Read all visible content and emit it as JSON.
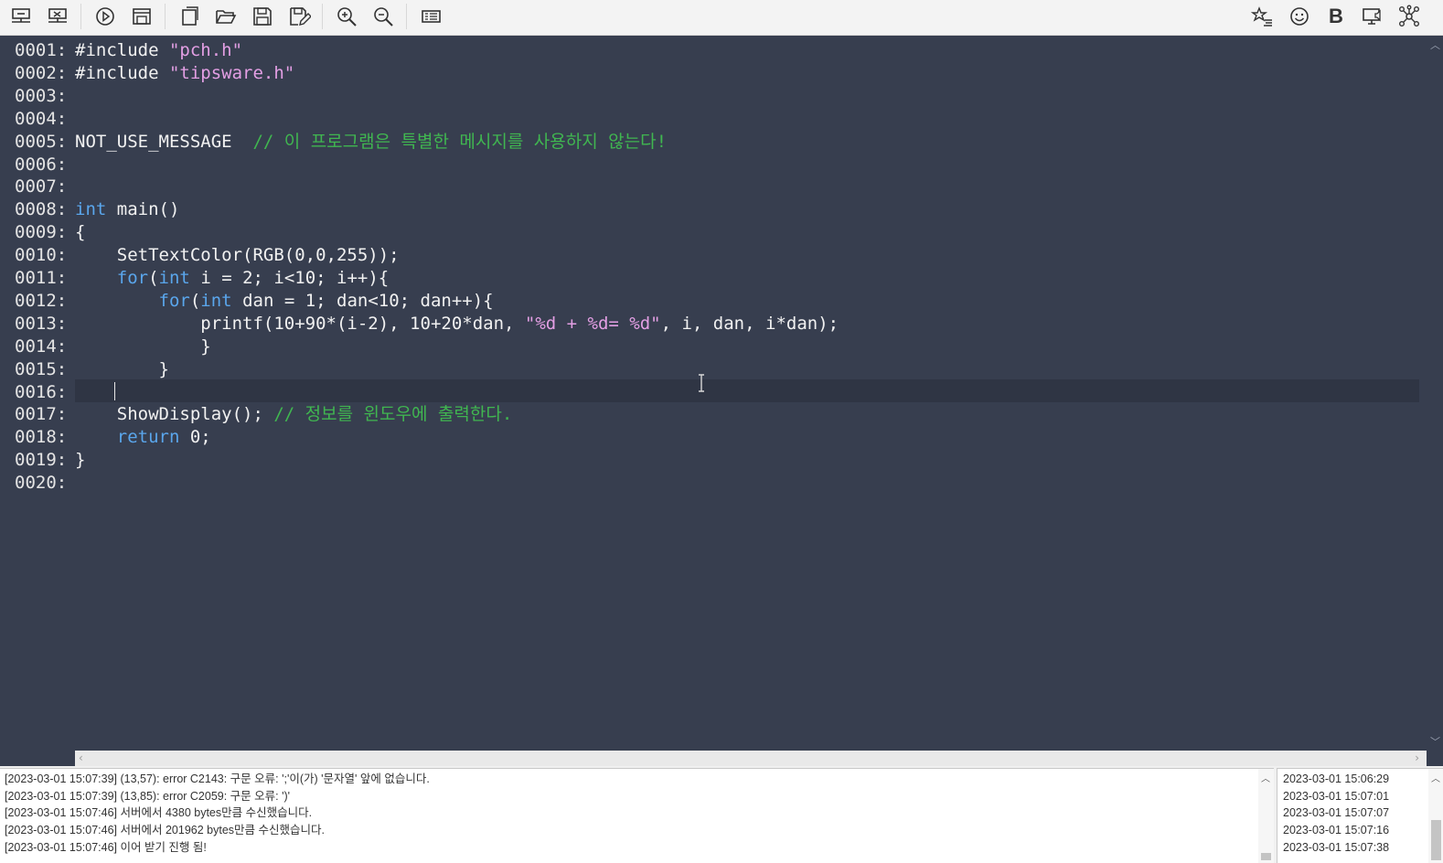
{
  "toolbar": {
    "buttons": [
      {
        "name": "connect-server-button",
        "icon": "monitor-connect-icon"
      },
      {
        "name": "disconnect-server-button",
        "icon": "monitor-disconnect-icon"
      },
      {
        "name": "run-button",
        "icon": "play-circle-icon"
      },
      {
        "name": "open-output-window-button",
        "icon": "window-icon"
      },
      {
        "name": "new-file-button",
        "icon": "new-document-icon"
      },
      {
        "name": "open-file-button",
        "icon": "folder-open-icon"
      },
      {
        "name": "save-button",
        "icon": "floppy-disk-icon"
      },
      {
        "name": "save-as-button",
        "icon": "floppy-edit-icon"
      },
      {
        "name": "zoom-in-button",
        "icon": "zoom-in-icon"
      },
      {
        "name": "zoom-out-button",
        "icon": "zoom-out-icon"
      },
      {
        "name": "toggle-panel-button",
        "icon": "list-panel-icon"
      },
      {
        "name": "favorites-button",
        "icon": "star-list-icon"
      },
      {
        "name": "emoji-button",
        "icon": "smiley-icon"
      },
      {
        "name": "bold-button",
        "icon": "bold-icon",
        "label": "B"
      },
      {
        "name": "broadcast-button",
        "icon": "monitor-speaker-icon"
      },
      {
        "name": "network-button",
        "icon": "network-icon"
      }
    ]
  },
  "editor": {
    "lines": [
      {
        "no": "0001:",
        "indent": "",
        "tokens": [
          {
            "t": "#include ",
            "c": "plain"
          },
          {
            "t": "\"pch.h\"",
            "c": "str"
          }
        ]
      },
      {
        "no": "0002:",
        "indent": "",
        "tokens": [
          {
            "t": "#include ",
            "c": "plain"
          },
          {
            "t": "\"tipsware.h\"",
            "c": "str"
          }
        ]
      },
      {
        "no": "0003:",
        "indent": "",
        "tokens": []
      },
      {
        "no": "0004:",
        "indent": "",
        "tokens": []
      },
      {
        "no": "0005:",
        "indent": "",
        "tokens": [
          {
            "t": "NOT_USE_MESSAGE  ",
            "c": "plain"
          },
          {
            "t": "// 이 프로그램은 특별한 메시지를 사용하지 않는다!",
            "c": "cmt"
          }
        ]
      },
      {
        "no": "0006:",
        "indent": "",
        "tokens": []
      },
      {
        "no": "0007:",
        "indent": "",
        "tokens": []
      },
      {
        "no": "0008:",
        "indent": "",
        "tokens": [
          {
            "t": "int",
            "c": "kw"
          },
          {
            "t": " main()",
            "c": "plain"
          }
        ]
      },
      {
        "no": "0009:",
        "indent": "",
        "tokens": [
          {
            "t": "{",
            "c": "plain"
          }
        ]
      },
      {
        "no": "0010:",
        "indent": "    ",
        "tokens": [
          {
            "t": "SetTextColor(RGB(0,0,255));",
            "c": "plain"
          }
        ]
      },
      {
        "no": "0011:",
        "indent": "    ",
        "tokens": [
          {
            "t": "for",
            "c": "kw"
          },
          {
            "t": "(",
            "c": "plain"
          },
          {
            "t": "int",
            "c": "kw"
          },
          {
            "t": " i = 2; i<10; i++){",
            "c": "plain"
          }
        ]
      },
      {
        "no": "0012:",
        "indent": "        ",
        "tokens": [
          {
            "t": "for",
            "c": "kw"
          },
          {
            "t": "(",
            "c": "plain"
          },
          {
            "t": "int",
            "c": "kw"
          },
          {
            "t": " dan = 1; dan<10; dan++){",
            "c": "plain"
          }
        ]
      },
      {
        "no": "0013:",
        "indent": "            ",
        "tokens": [
          {
            "t": "printf(10+90*(i-2), 10+20*dan, ",
            "c": "plain"
          },
          {
            "t": "\"%d + %d= %d\"",
            "c": "str"
          },
          {
            "t": ", i, dan, i*dan);",
            "c": "plain"
          }
        ]
      },
      {
        "no": "0014:",
        "indent": "            ",
        "tokens": [
          {
            "t": "}",
            "c": "plain"
          }
        ]
      },
      {
        "no": "0015:",
        "indent": "        ",
        "tokens": [
          {
            "t": "}",
            "c": "plain"
          }
        ]
      },
      {
        "no": "0016:",
        "indent": "",
        "tokens": []
      },
      {
        "no": "0017:",
        "indent": "    ",
        "tokens": [
          {
            "t": "ShowDisplay(); ",
            "c": "plain"
          },
          {
            "t": "// 정보를 윈도우에 출력한다.",
            "c": "cmt"
          }
        ]
      },
      {
        "no": "0018:",
        "indent": "    ",
        "tokens": [
          {
            "t": "return",
            "c": "kw"
          },
          {
            "t": " 0;",
            "c": "plain"
          }
        ]
      },
      {
        "no": "0019:",
        "indent": "",
        "tokens": [
          {
            "t": "}",
            "c": "plain"
          }
        ]
      },
      {
        "no": "0020:",
        "indent": "",
        "tokens": []
      }
    ]
  },
  "log": {
    "lines": [
      "[2023-03-01 15:07:39] (13,57): error C2143: 구문 오류: ';'이(가) '문자열' 앞에 없습니다.",
      "[2023-03-01 15:07:39] (13,85): error C2059: 구문 오류: ')'",
      "[2023-03-01 15:07:46] 서버에서 4380 bytes만큼 수신했습니다.",
      "[2023-03-01 15:07:46] 서버에서 201962 bytes만큼 수신했습니다.",
      "[2023-03-01 15:07:46] 이어 받기 진행 됨!"
    ]
  },
  "timestamps": {
    "lines": [
      "2023-03-01 15:06:29",
      "2023-03-01 15:07:01",
      "2023-03-01 15:07:07",
      "2023-03-01 15:07:16",
      "2023-03-01 15:07:38"
    ]
  },
  "colors": {
    "editor_bg": "#373e4f",
    "keyword": "#5aa6ec",
    "string": "#e39fe4",
    "comment": "#40b650",
    "text": "#f1f1f1"
  }
}
